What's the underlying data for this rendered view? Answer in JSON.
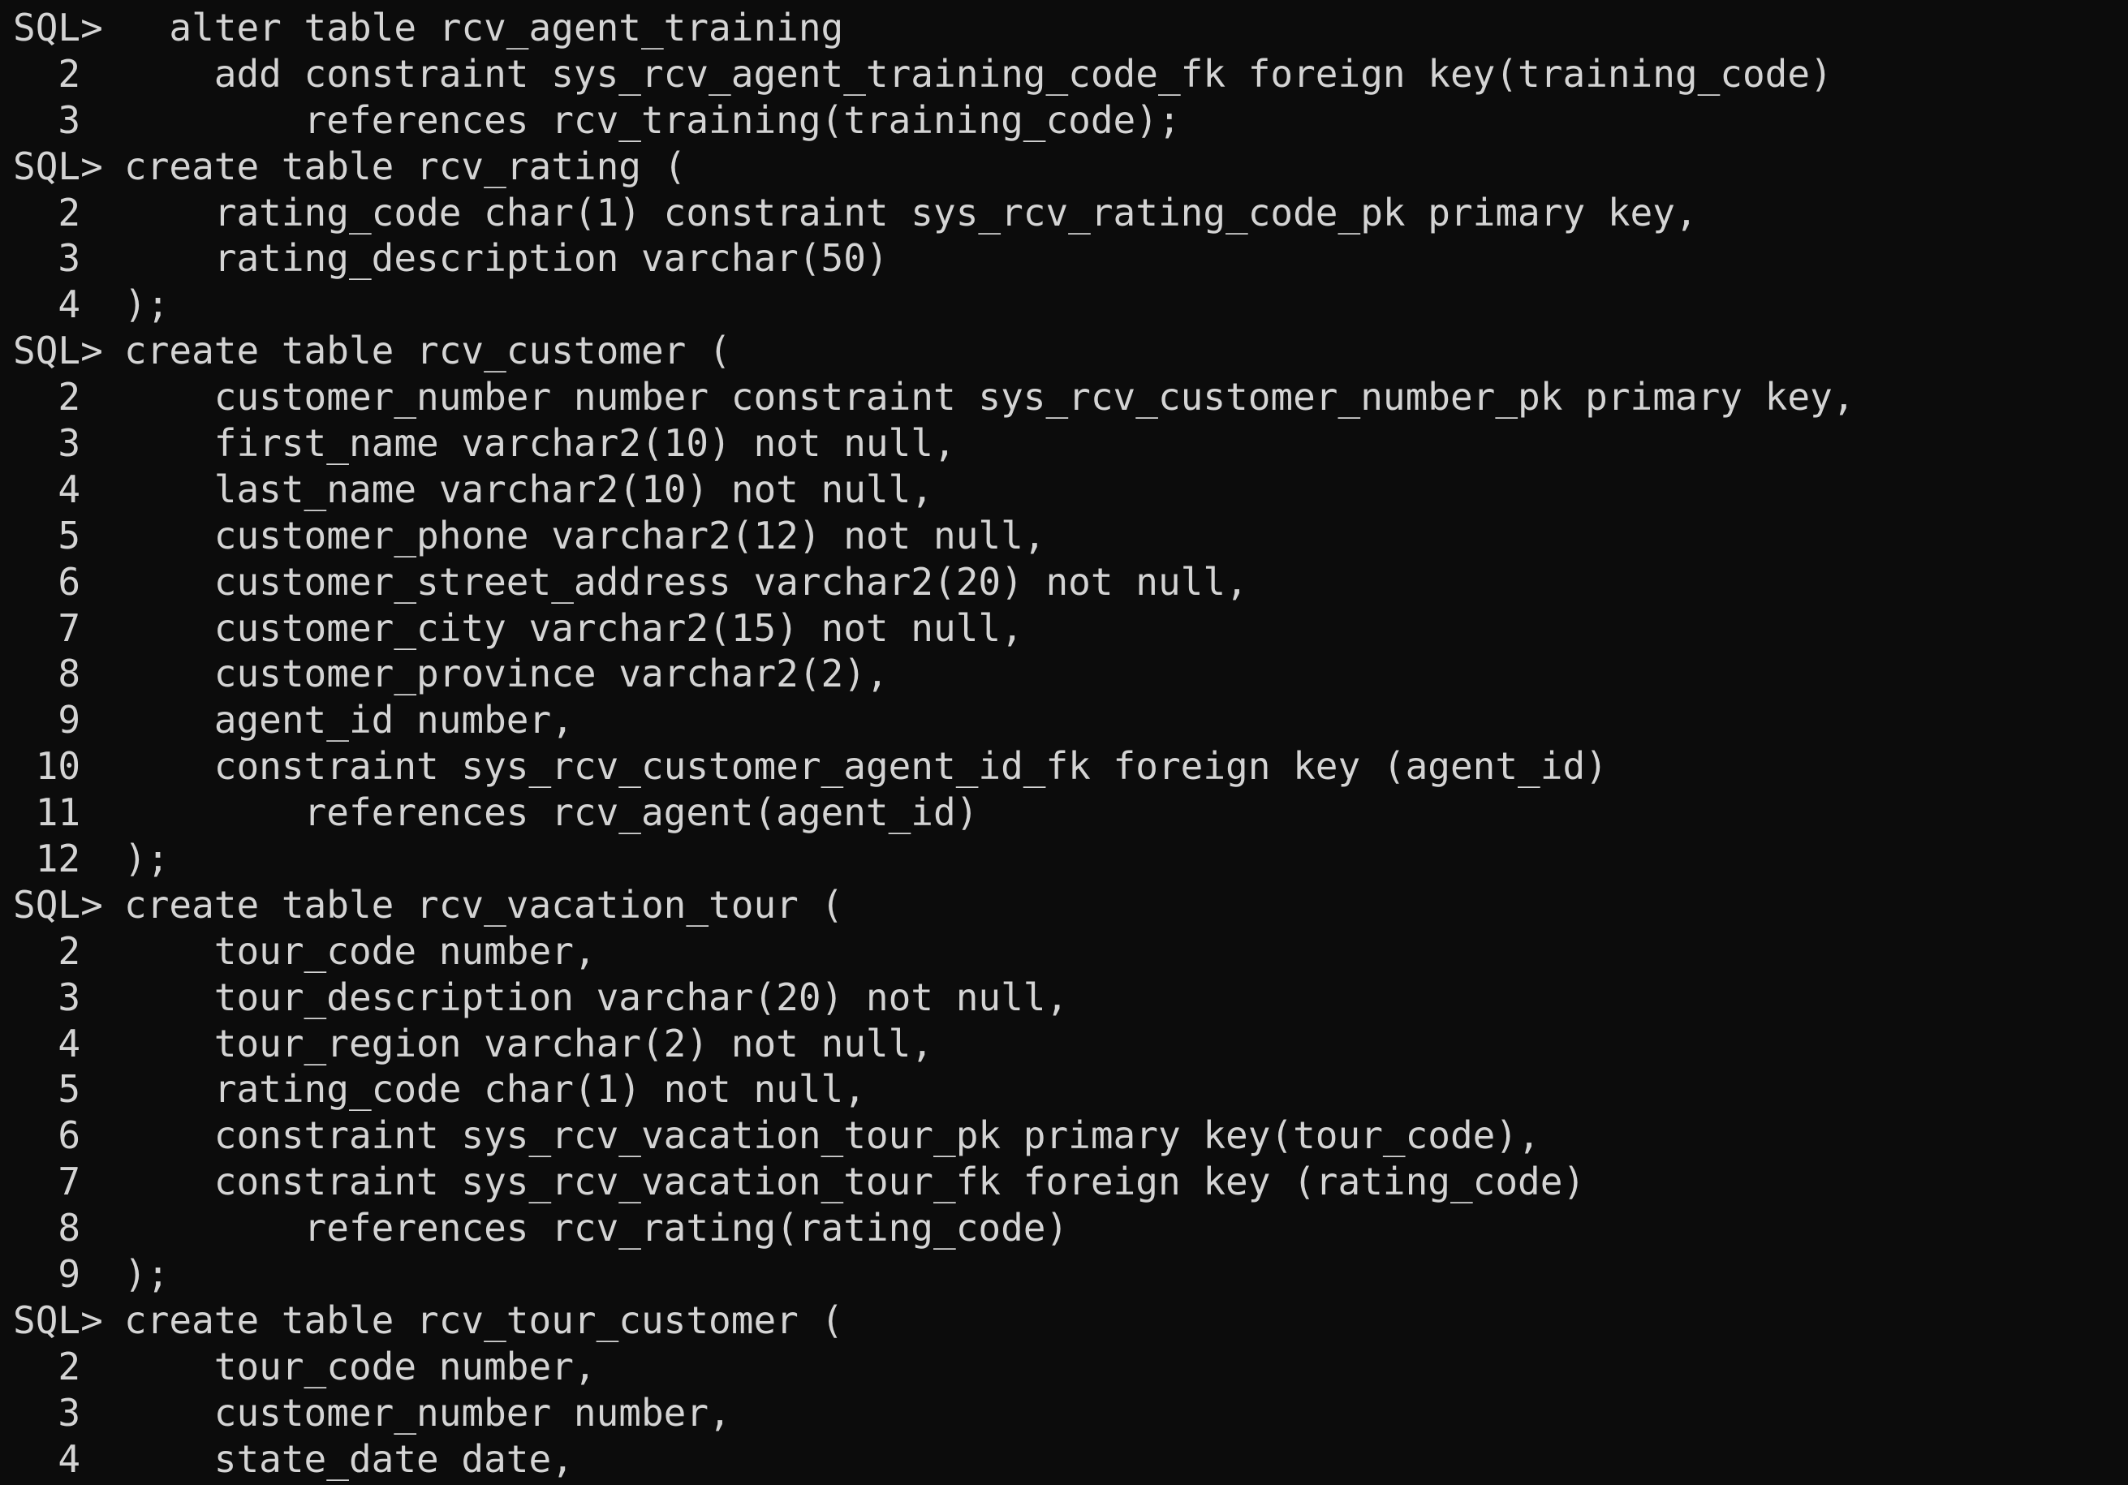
{
  "terminal": {
    "lines": [
      {
        "prefix": "SQL>",
        "code": "  alter table rcv_agent_training"
      },
      {
        "prefix": "  2",
        "code": "    add constraint sys_rcv_agent_training_code_fk foreign key(training_code)"
      },
      {
        "prefix": "  3",
        "code": "        references rcv_training(training_code);"
      },
      {
        "prefix": "SQL>",
        "code": "create table rcv_rating ("
      },
      {
        "prefix": "  2",
        "code": "    rating_code char(1) constraint sys_rcv_rating_code_pk primary key,"
      },
      {
        "prefix": "  3",
        "code": "    rating_description varchar(50)"
      },
      {
        "prefix": "  4",
        "code": ");"
      },
      {
        "prefix": "SQL>",
        "code": "create table rcv_customer ("
      },
      {
        "prefix": "  2",
        "code": "    customer_number number constraint sys_rcv_customer_number_pk primary key,"
      },
      {
        "prefix": "  3",
        "code": "    first_name varchar2(10) not null,"
      },
      {
        "prefix": "  4",
        "code": "    last_name varchar2(10) not null,"
      },
      {
        "prefix": "  5",
        "code": "    customer_phone varchar2(12) not null,"
      },
      {
        "prefix": "  6",
        "code": "    customer_street_address varchar2(20) not null,"
      },
      {
        "prefix": "  7",
        "code": "    customer_city varchar2(15) not null,"
      },
      {
        "prefix": "  8",
        "code": "    customer_province varchar2(2),"
      },
      {
        "prefix": "  9",
        "code": "    agent_id number,"
      },
      {
        "prefix": " 10",
        "code": "    constraint sys_rcv_customer_agent_id_fk foreign key (agent_id)"
      },
      {
        "prefix": " 11",
        "code": "        references rcv_agent(agent_id)"
      },
      {
        "prefix": " 12",
        "code": ");"
      },
      {
        "prefix": "SQL>",
        "code": "create table rcv_vacation_tour ("
      },
      {
        "prefix": "  2",
        "code": "    tour_code number,"
      },
      {
        "prefix": "  3",
        "code": "    tour_description varchar(20) not null,"
      },
      {
        "prefix": "  4",
        "code": "    tour_region varchar(2) not null,"
      },
      {
        "prefix": "  5",
        "code": "    rating_code char(1) not null,"
      },
      {
        "prefix": "  6",
        "code": "    constraint sys_rcv_vacation_tour_pk primary key(tour_code),"
      },
      {
        "prefix": "  7",
        "code": "    constraint sys_rcv_vacation_tour_fk foreign key (rating_code)"
      },
      {
        "prefix": "  8",
        "code": "        references rcv_rating(rating_code)"
      },
      {
        "prefix": "  9",
        "code": ");"
      },
      {
        "prefix": "SQL>",
        "code": "create table rcv_tour_customer ("
      },
      {
        "prefix": "  2",
        "code": "    tour_code number,"
      },
      {
        "prefix": "  3",
        "code": "    customer_number number,"
      },
      {
        "prefix": "  4",
        "code": "    state_date date,"
      }
    ]
  },
  "colors": {
    "background": "#0c0c0c",
    "text": "#d4d4d4"
  }
}
